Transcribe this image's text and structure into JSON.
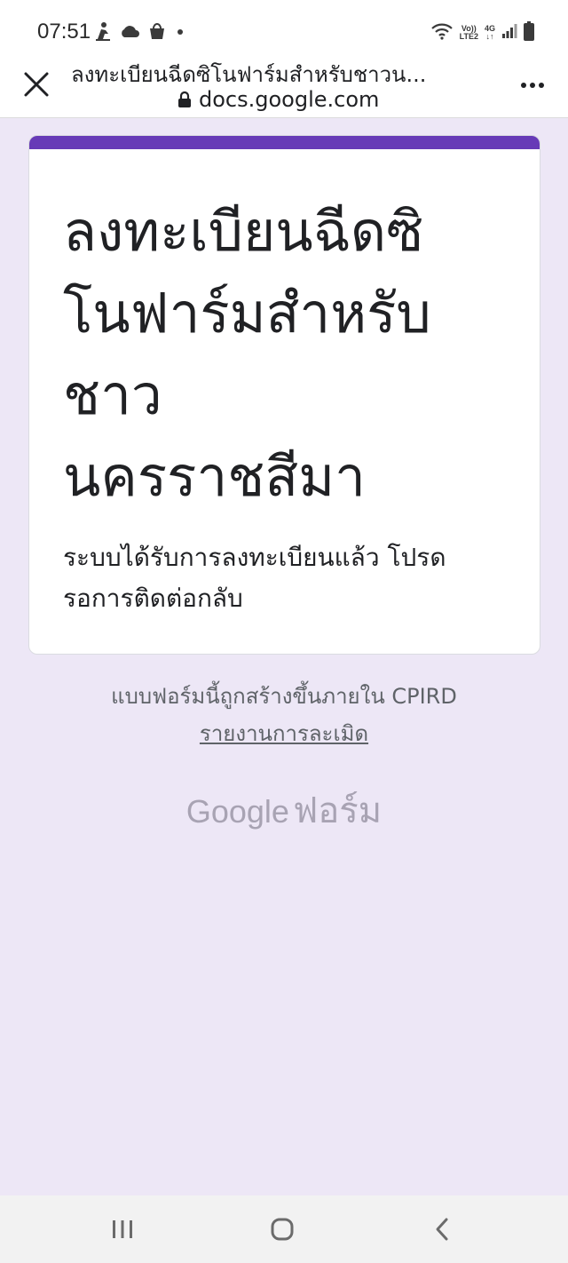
{
  "status_bar": {
    "time": "07:51",
    "left_icons": [
      "person-icon",
      "cloud-icon",
      "shopping-bag-icon",
      "notification-dot-icon"
    ],
    "volte_top": "Vo))",
    "volte_bottom": "LTE2",
    "network": "4G",
    "right_icons": [
      "wifi-icon",
      "signal-icon",
      "battery-icon"
    ]
  },
  "browser": {
    "page_title": "ลงทะเบียนฉีดซิโนฟาร์มสำหรับชาวน...",
    "url": "docs.google.com",
    "close_icon": "close-icon",
    "lock_icon": "lock-icon",
    "more_icon": "more-vert-icon"
  },
  "form": {
    "accent_color": "#673ab7",
    "title": "ลงทะเบียนฉีดซิโนฟาร์มสำหรับชาว นครราชสีมา",
    "title_lines": [
      "ลงทะเบียนฉีดซิ",
      "โนฟาร์มสำหรับ",
      "ชาว",
      "นครราชสีมา"
    ],
    "confirmation": "ระบบได้รับการลงทะเบียนแล้ว โปรดรอการติดต่อกลับ",
    "confirmation_lines": [
      "ระบบได้รับการลงทะเบียนแล้ว โปรด",
      "รอการติดต่อกลับ"
    ]
  },
  "footer": {
    "created_note": "แบบฟอร์มนี้ถูกสร้างขึ้นภายใน CPIRD",
    "report_link": "รายงานการละเมิด",
    "brand_google": "Google",
    "brand_forms": "ฟอร์ม"
  },
  "nav_bar": {
    "icons": [
      "recent-apps-icon",
      "home-icon",
      "back-icon"
    ]
  },
  "colors": {
    "background": "#ede7f6",
    "card": "#ffffff",
    "text": "#202124",
    "muted": "#5f6368"
  }
}
